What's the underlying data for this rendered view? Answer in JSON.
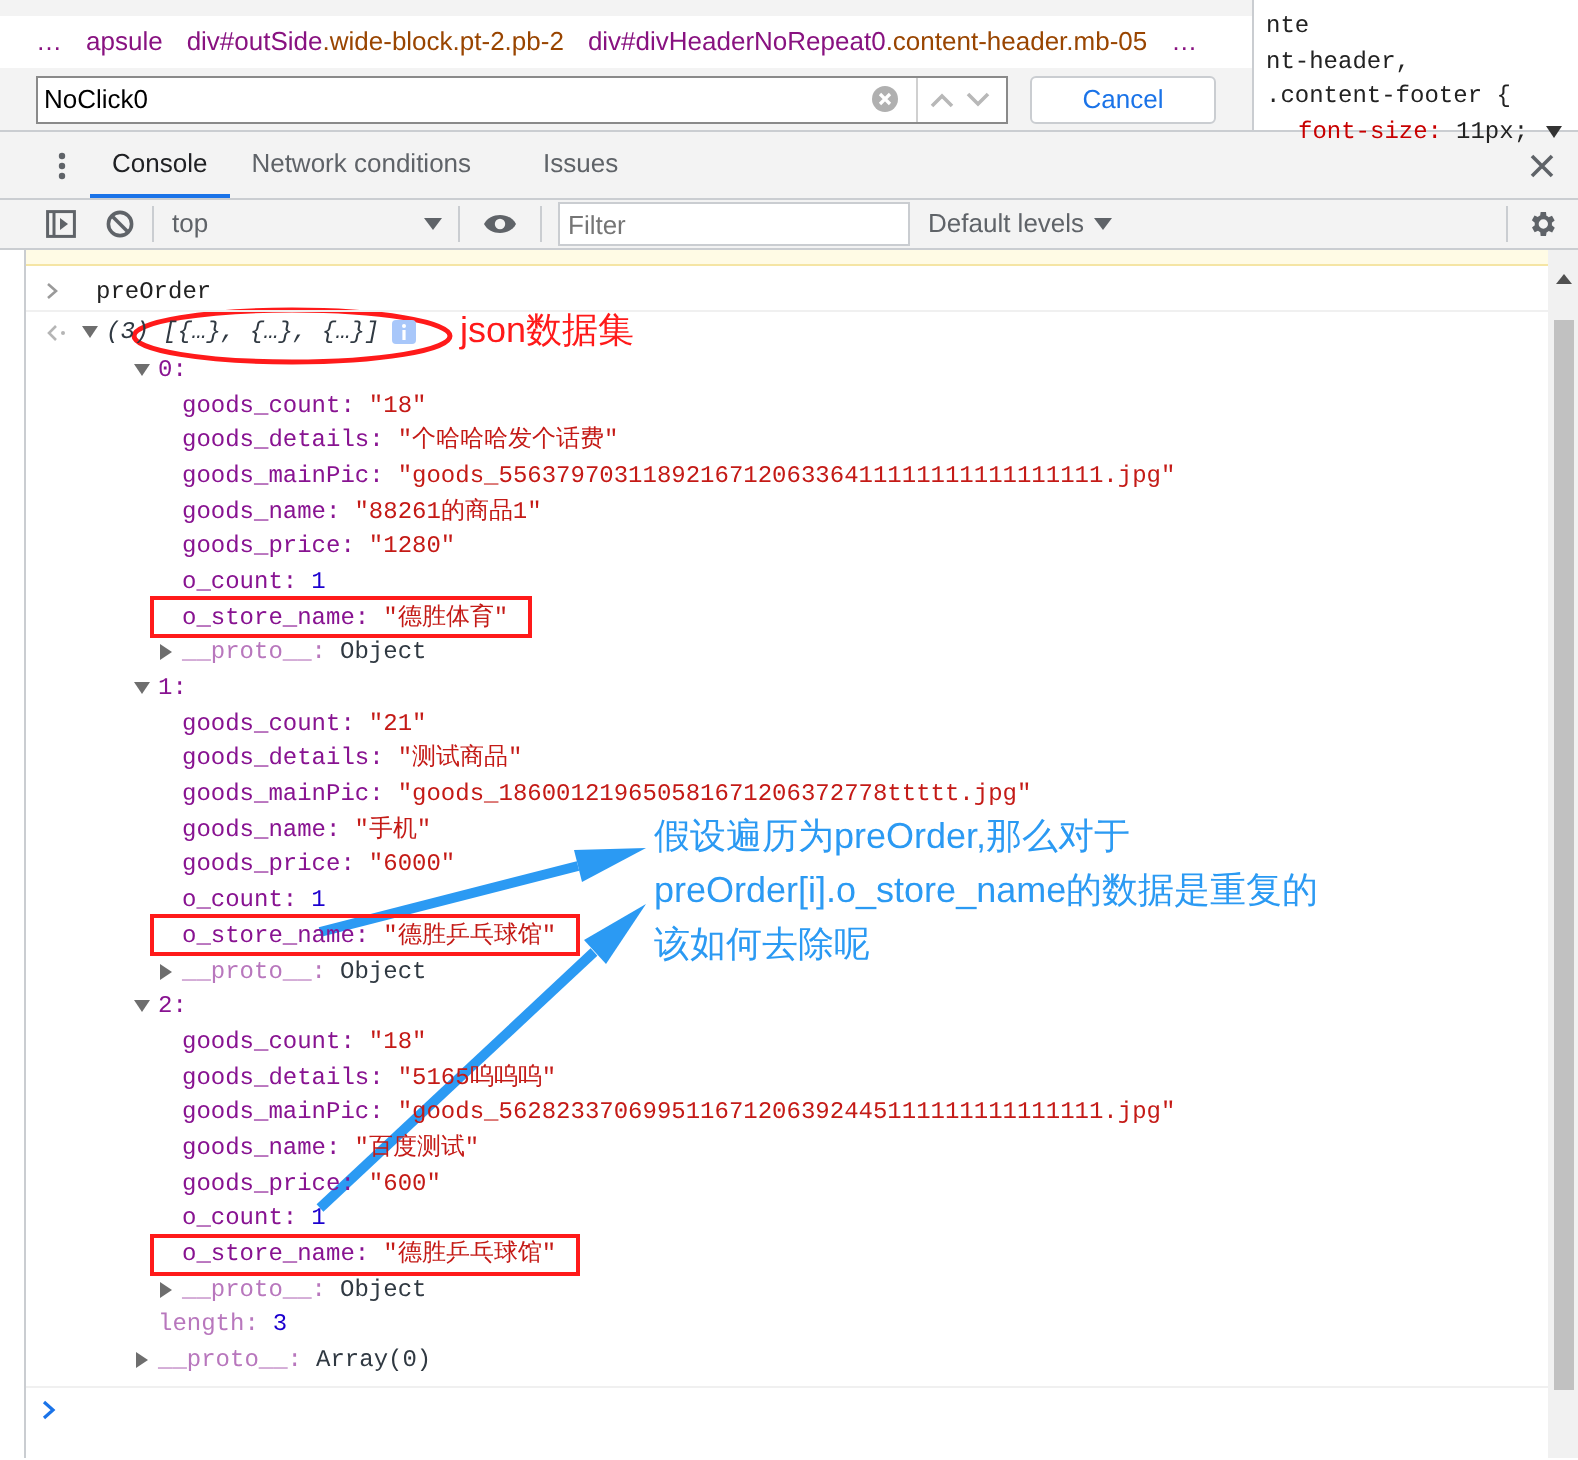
{
  "breadcrumbs": [
    {
      "tag": "…"
    },
    {
      "tag": "apsule"
    },
    {
      "tag": "div#outSide",
      "classes": ".wide-block.pt-2.pb-2"
    },
    {
      "tag": "div#divHeaderNoRepeat0",
      "classes": ".content-header.mb-05"
    },
    {
      "tag": "…"
    }
  ],
  "search": {
    "value": "NoClick0",
    "cancel": "Cancel"
  },
  "styles_pane": {
    "lines": [
      {
        "kind": "selector",
        "text": "nte"
      },
      {
        "kind": "selector",
        "text": "nt-header,"
      },
      {
        "kind": "selector",
        "text": ".content-footer {"
      },
      {
        "kind": "declaration",
        "property": "font-size:",
        "value": "11px;"
      }
    ]
  },
  "drawer_tabs": [
    {
      "label": "Console",
      "selected": true
    },
    {
      "label": "Network conditions",
      "selected": false
    },
    {
      "label": "Issues",
      "selected": false
    }
  ],
  "toolbar": {
    "context": "top",
    "filter_placeholder": "Filter",
    "levels": "Default levels"
  },
  "console": {
    "input": "preOrder",
    "result": {
      "count": "(3)",
      "preview": "[{…}, {…}, {…}]",
      "expanded": true,
      "children": [
        {
          "key": "0:",
          "expanded": true,
          "children": [
            {
              "key": "goods_count:",
              "value": "\"18\"",
              "kind": "string",
              "boxed": false
            },
            {
              "key": "goods_details:",
              "value": "\"个哈哈哈发个话费\"",
              "kind": "string",
              "boxed": false
            },
            {
              "key": "goods_mainPic:",
              "value": "\"goods_556379703118921671206336411111111111111111.jpg\"",
              "kind": "string",
              "boxed": false
            },
            {
              "key": "goods_name:",
              "value": "\"88261的商品1\"",
              "kind": "string",
              "boxed": false
            },
            {
              "key": "goods_price:",
              "value": "\"1280\"",
              "kind": "string",
              "boxed": false
            },
            {
              "key": "o_count:",
              "value": "1",
              "kind": "number",
              "boxed": false
            },
            {
              "key": "o_store_name:",
              "value": "\"德胜体育\"",
              "kind": "string",
              "boxed": true
            },
            {
              "key": "__proto__:",
              "value": "Object",
              "kind": "object",
              "expanded": false,
              "faded": true
            }
          ]
        },
        {
          "key": "1:",
          "expanded": true,
          "children": [
            {
              "key": "goods_count:",
              "value": "\"21\"",
              "kind": "string",
              "boxed": false
            },
            {
              "key": "goods_details:",
              "value": "\"测试商品\"",
              "kind": "string",
              "boxed": false
            },
            {
              "key": "goods_mainPic:",
              "value": "\"goods_186001219650581671206372778ttttt.jpg\"",
              "kind": "string",
              "boxed": false
            },
            {
              "key": "goods_name:",
              "value": "\"手机\"",
              "kind": "string",
              "boxed": false
            },
            {
              "key": "goods_price:",
              "value": "\"6000\"",
              "kind": "string",
              "boxed": false
            },
            {
              "key": "o_count:",
              "value": "1",
              "kind": "number",
              "boxed": false
            },
            {
              "key": "o_store_name:",
              "value": "\"德胜乒乓球馆\"",
              "kind": "string",
              "boxed": true
            },
            {
              "key": "__proto__:",
              "value": "Object",
              "kind": "object",
              "expanded": false,
              "faded": true
            }
          ]
        },
        {
          "key": "2:",
          "expanded": true,
          "children": [
            {
              "key": "goods_count:",
              "value": "\"18\"",
              "kind": "string",
              "boxed": false
            },
            {
              "key": "goods_details:",
              "value": "\"5165呜呜呜\"",
              "kind": "string",
              "boxed": false
            },
            {
              "key": "goods_mainPic:",
              "value": "\"goods_562823370699511671206392445111111111111111.jpg\"",
              "kind": "string",
              "boxed": false
            },
            {
              "key": "goods_name:",
              "value": "\"百度测试\"",
              "kind": "string",
              "boxed": false
            },
            {
              "key": "goods_price:",
              "value": "\"600\"",
              "kind": "string",
              "boxed": false
            },
            {
              "key": "o_count:",
              "value": "1",
              "kind": "number",
              "boxed": false
            },
            {
              "key": "o_store_name:",
              "value": "\"德胜乒乓球馆\"",
              "kind": "string",
              "boxed": true
            },
            {
              "key": "__proto__:",
              "value": "Object",
              "kind": "object",
              "expanded": false,
              "faded": true
            }
          ]
        },
        {
          "key": "length:",
          "value": "3",
          "kind": "number",
          "faded": true
        },
        {
          "key": "__proto__:",
          "value": "Array(0)",
          "kind": "object",
          "expanded": false,
          "faded": true
        }
      ]
    }
  },
  "annotations": {
    "label": "json数据集",
    "question": [
      "假设遍历为preOrder,那么对于",
      "preOrder[i].o_store_name的数据是重复的",
      "该如何去除呢"
    ]
  }
}
